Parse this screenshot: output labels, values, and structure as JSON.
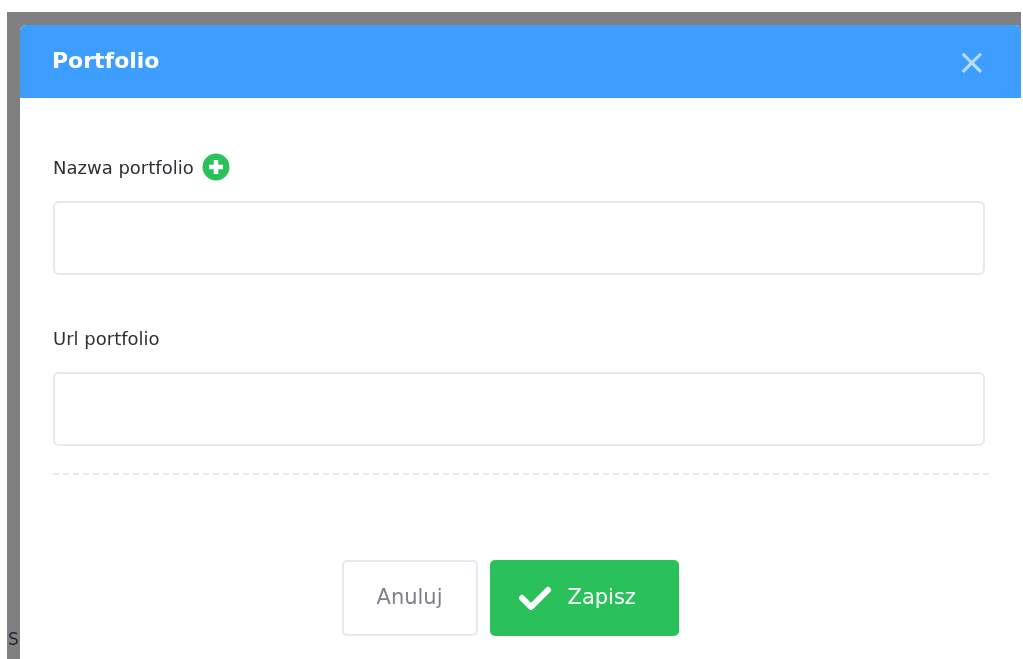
{
  "background": {
    "text_fragment": "S"
  },
  "dialog": {
    "title": "Portfolio",
    "close": "×"
  },
  "fields": [
    {
      "label": "Nazwa portfolio",
      "add_icon": true
    },
    {
      "label": "Url portfolio",
      "add_icon": false
    }
  ],
  "buttons": [
    {
      "kind": "cancel",
      "label": "Anuluj"
    },
    {
      "kind": "save",
      "label": "Zapisz"
    }
  ]
}
